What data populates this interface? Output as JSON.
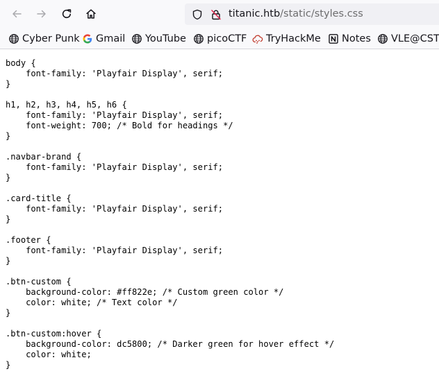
{
  "browser": {
    "url_host": "titanic.htb",
    "url_path": "/static/styles.css"
  },
  "bookmarks": [
    {
      "label": "Cyber Punk",
      "icon": "globe-icon"
    },
    {
      "label": "Gmail",
      "icon": "google-icon"
    },
    {
      "label": "YouTube",
      "icon": "globe-icon"
    },
    {
      "label": "picoCTF",
      "icon": "globe-icon"
    },
    {
      "label": "TryHackMe",
      "icon": "cloud-icon"
    },
    {
      "label": "Notes",
      "icon": "notion-icon"
    },
    {
      "label": "VLE@CST",
      "icon": "globe-icon"
    }
  ],
  "page": {
    "source_lines": [
      "body {",
      "    font-family: 'Playfair Display', serif;",
      "}",
      "",
      "h1, h2, h3, h4, h5, h6 {",
      "    font-family: 'Playfair Display', serif;",
      "    font-weight: 700; /* Bold for headings */",
      "}",
      "",
      ".navbar-brand {",
      "    font-family: 'Playfair Display', serif;",
      "}",
      "",
      ".card-title {",
      "    font-family: 'Playfair Display', serif;",
      "}",
      "",
      ".footer {",
      "    font-family: 'Playfair Display', serif;",
      "}",
      "",
      ".btn-custom {",
      "    background-color: #ff822e; /* Custom green color */",
      "    color: white; /* Text color */",
      "}",
      "",
      ".btn-custom:hover {",
      "    background-color: dc5800; /* Darker green for hover effect */",
      "    color: white;",
      "}"
    ]
  },
  "colors": {
    "toolbar_bg": "#f9f9fb",
    "urlbar_bg": "#f0f0f4",
    "text": "#15141a",
    "url_path": "#6d6d6e",
    "tryhackme_red": "#c0392b"
  }
}
